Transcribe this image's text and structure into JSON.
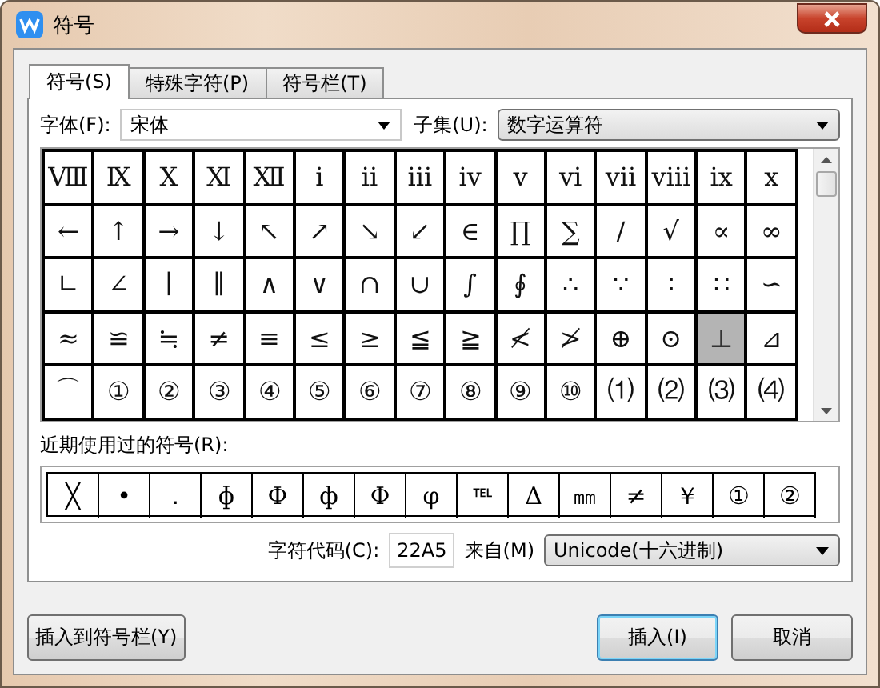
{
  "window": {
    "title": "符号"
  },
  "tabs": [
    {
      "label": "符号(S)",
      "selected": true
    },
    {
      "label": "特殊字符(P)",
      "selected": false
    },
    {
      "label": "符号栏(T)",
      "selected": false
    }
  ],
  "font_field": {
    "label": "字体(F):",
    "value": "宋体"
  },
  "subset_field": {
    "label": "子集(U):",
    "value": "数字运算符"
  },
  "symbol_grid": [
    [
      {
        "s": "Ⅷ",
        "selected": false
      },
      {
        "s": "Ⅸ",
        "selected": false
      },
      {
        "s": "Ⅹ",
        "selected": false
      },
      {
        "s": "Ⅺ",
        "selected": false
      },
      {
        "s": "Ⅻ",
        "selected": false
      },
      {
        "s": "ⅰ",
        "selected": false
      },
      {
        "s": "ⅱ",
        "selected": false
      },
      {
        "s": "ⅲ",
        "selected": false
      },
      {
        "s": "ⅳ",
        "selected": false
      },
      {
        "s": "ⅴ",
        "selected": false
      },
      {
        "s": "ⅵ",
        "selected": false
      },
      {
        "s": "ⅶ",
        "selected": false
      },
      {
        "s": "ⅷ",
        "selected": false
      },
      {
        "s": "ⅸ",
        "selected": false
      },
      {
        "s": "ⅹ",
        "selected": false
      }
    ],
    [
      {
        "s": "←",
        "selected": false
      },
      {
        "s": "↑",
        "selected": false
      },
      {
        "s": "→",
        "selected": false
      },
      {
        "s": "↓",
        "selected": false
      },
      {
        "s": "↖",
        "selected": false
      },
      {
        "s": "↗",
        "selected": false
      },
      {
        "s": "↘",
        "selected": false
      },
      {
        "s": "↙",
        "selected": false
      },
      {
        "s": "∈",
        "selected": false
      },
      {
        "s": "∏",
        "selected": false
      },
      {
        "s": "∑",
        "selected": false
      },
      {
        "s": "∕",
        "selected": false
      },
      {
        "s": "√",
        "selected": false
      },
      {
        "s": "∝",
        "selected": false
      },
      {
        "s": "∞",
        "selected": false
      }
    ],
    [
      {
        "s": "∟",
        "selected": false
      },
      {
        "s": "∠",
        "selected": false
      },
      {
        "s": "∣",
        "selected": false
      },
      {
        "s": "∥",
        "selected": false
      },
      {
        "s": "∧",
        "selected": false
      },
      {
        "s": "∨",
        "selected": false
      },
      {
        "s": "∩",
        "selected": false
      },
      {
        "s": "∪",
        "selected": false
      },
      {
        "s": "∫",
        "selected": false
      },
      {
        "s": "∮",
        "selected": false
      },
      {
        "s": "∴",
        "selected": false
      },
      {
        "s": "∵",
        "selected": false
      },
      {
        "s": "∶",
        "selected": false
      },
      {
        "s": "∷",
        "selected": false
      },
      {
        "s": "∽",
        "selected": false
      }
    ],
    [
      {
        "s": "≈",
        "selected": false
      },
      {
        "s": "≌",
        "selected": false
      },
      {
        "s": "≒",
        "selected": false
      },
      {
        "s": "≠",
        "selected": false
      },
      {
        "s": "≡",
        "selected": false
      },
      {
        "s": "≤",
        "selected": false
      },
      {
        "s": "≥",
        "selected": false
      },
      {
        "s": "≦",
        "selected": false
      },
      {
        "s": "≧",
        "selected": false
      },
      {
        "s": "≮",
        "selected": false
      },
      {
        "s": "≯",
        "selected": false
      },
      {
        "s": "⊕",
        "selected": false
      },
      {
        "s": "⊙",
        "selected": false
      },
      {
        "s": "⊥",
        "selected": true
      },
      {
        "s": "⊿",
        "selected": false
      }
    ],
    [
      {
        "s": "⌒",
        "selected": false
      },
      {
        "s": "①",
        "selected": false
      },
      {
        "s": "②",
        "selected": false
      },
      {
        "s": "③",
        "selected": false
      },
      {
        "s": "④",
        "selected": false
      },
      {
        "s": "⑤",
        "selected": false
      },
      {
        "s": "⑥",
        "selected": false
      },
      {
        "s": "⑦",
        "selected": false
      },
      {
        "s": "⑧",
        "selected": false
      },
      {
        "s": "⑨",
        "selected": false
      },
      {
        "s": "⑩",
        "selected": false
      },
      {
        "s": "⑴",
        "selected": false
      },
      {
        "s": "⑵",
        "selected": false
      },
      {
        "s": "⑶",
        "selected": false
      },
      {
        "s": "⑷",
        "selected": false
      }
    ]
  ],
  "recent": {
    "label": "近期使用过的符号(R):",
    "symbols": [
      "╳",
      "•",
      "．",
      "ɸ",
      "Ф",
      "ф",
      "Φ",
      "φ",
      "℡",
      "Δ",
      "㎜",
      "≠",
      "￥",
      "①",
      "②"
    ]
  },
  "char_code": {
    "label": "字符代码(C):",
    "value": "22A5"
  },
  "from_field": {
    "label": "来自(M)",
    "value": "Unicode(十六进制)"
  },
  "buttons": [
    {
      "label": "插入到符号栏(Y)",
      "default": false
    },
    {
      "label": "插入(I)",
      "default": true
    },
    {
      "label": "取消",
      "default": false
    }
  ]
}
